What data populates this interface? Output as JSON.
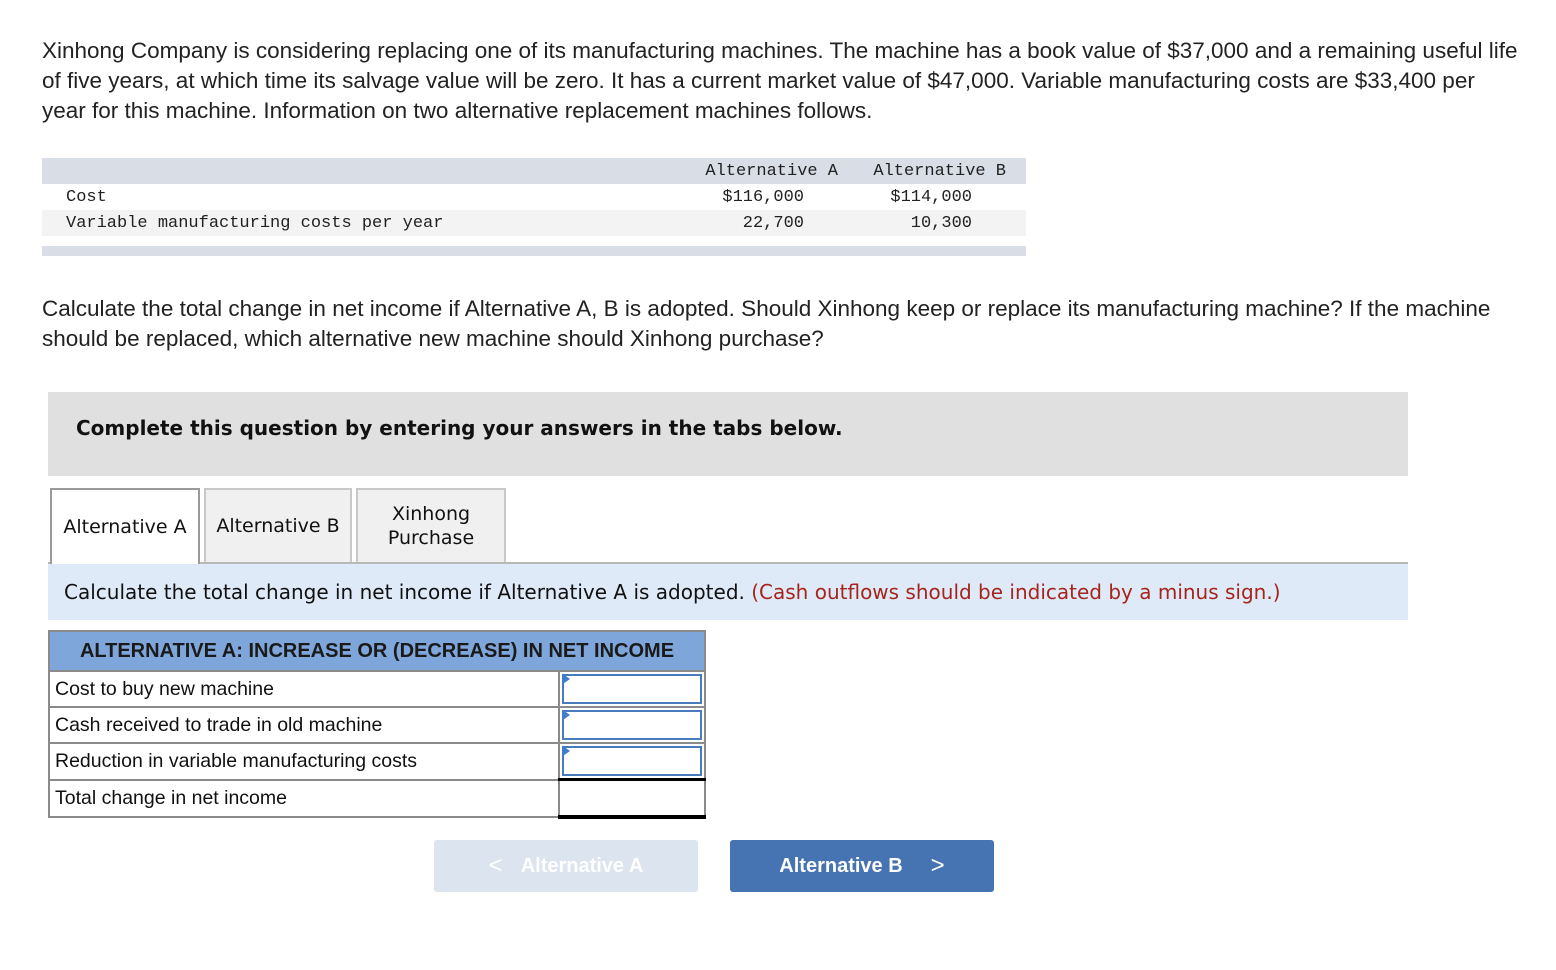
{
  "intro": "Xinhong Company is considering replacing one of its manufacturing machines. The machine has a book value of $37,000 and a remaining useful life of five years, at which time its salvage value will be zero. It has a current market value of $47,000. Variable manufacturing costs are $33,400 per year for this machine. Information on two alternative replacement machines follows.",
  "info_table": {
    "columns": [
      "",
      "Alternative A",
      "Alternative B"
    ],
    "rows": [
      {
        "label": "Cost",
        "a": "$116,000",
        "b": "$114,000"
      },
      {
        "label": "Variable manufacturing costs per year",
        "a": "22,700",
        "b": "10,300"
      }
    ]
  },
  "question": "Calculate the total change in net income if Alternative A, B is adopted. Should Xinhong keep or replace its manufacturing machine? If the machine should be replaced, which alternative new machine should Xinhong purchase?",
  "instruction": "Complete this question by entering your answers in the tabs below.",
  "tabs": [
    {
      "label": "Alternative A",
      "active": true
    },
    {
      "label": "Alternative B",
      "active": false
    },
    {
      "label": "Xinhong\nPurchase",
      "active": false
    }
  ],
  "prompt": {
    "text": "Calculate the total change in net income if Alternative A is adopted.",
    "note": "(Cash outflows should be indicated by a minus sign.)",
    "note_color": "#a6241c"
  },
  "answer_table": {
    "title": "ALTERNATIVE A: INCREASE OR (DECREASE) IN NET INCOME",
    "header_color": "#7ea6db",
    "rows": [
      {
        "label": "Cost to buy new machine",
        "value": ""
      },
      {
        "label": "Cash received to trade in old machine",
        "value": ""
      },
      {
        "label": "Reduction in variable manufacturing costs",
        "value": ""
      },
      {
        "label": "Total change in net income",
        "value": ""
      }
    ]
  },
  "nav": {
    "prev": {
      "label": "Alternative A",
      "icon": "chevron-left-icon",
      "glyph": "<",
      "enabled": false
    },
    "next": {
      "label": "Alternative B",
      "icon": "chevron-right-icon",
      "glyph": ">",
      "enabled": true,
      "color": "#4674b2"
    }
  }
}
